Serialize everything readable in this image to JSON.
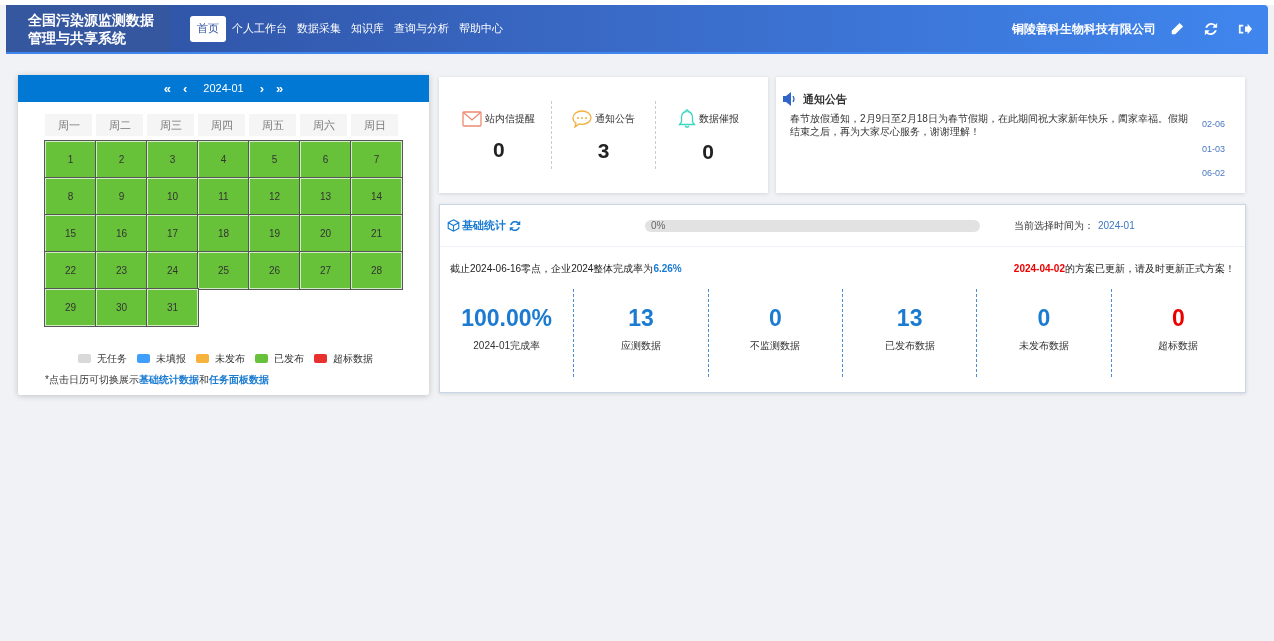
{
  "header": {
    "title": "全国污染源监测数据管理与共享系统",
    "nav": [
      {
        "label": "首页",
        "selected": true
      },
      {
        "label": "个人工作台",
        "selected": false
      },
      {
        "label": "数据采集",
        "selected": false
      },
      {
        "label": "知识库",
        "selected": false
      },
      {
        "label": "查询与分析",
        "selected": false
      },
      {
        "label": "帮助中心",
        "selected": false
      }
    ],
    "company": "铜陵善科生物科技有限公司"
  },
  "calendar": {
    "nav": {
      "first": "«",
      "prev": "‹",
      "month": "2024-01",
      "next": "›",
      "last": "»"
    },
    "weekdays": [
      "周一",
      "周二",
      "周三",
      "周四",
      "周五",
      "周六",
      "周日"
    ],
    "days": [
      {
        "day": "1",
        "color": "#67c23a"
      },
      {
        "day": "2",
        "color": "#67c23a"
      },
      {
        "day": "3",
        "color": "#67c23a"
      },
      {
        "day": "4",
        "color": "#67c23a"
      },
      {
        "day": "5",
        "color": "#67c23a"
      },
      {
        "day": "6",
        "color": "#67c23a"
      },
      {
        "day": "7",
        "color": "#67c23a"
      },
      {
        "day": "8",
        "color": "#67c23a"
      },
      {
        "day": "9",
        "color": "#67c23a"
      },
      {
        "day": "10",
        "color": "#67c23a"
      },
      {
        "day": "11",
        "color": "#67c23a"
      },
      {
        "day": "12",
        "color": "#67c23a"
      },
      {
        "day": "13",
        "color": "#67c23a"
      },
      {
        "day": "14",
        "color": "#67c23a"
      },
      {
        "day": "15",
        "color": "#67c23a"
      },
      {
        "day": "16",
        "color": "#67c23a"
      },
      {
        "day": "17",
        "color": "#67c23a"
      },
      {
        "day": "18",
        "color": "#67c23a"
      },
      {
        "day": "19",
        "color": "#67c23a"
      },
      {
        "day": "20",
        "color": "#67c23a"
      },
      {
        "day": "21",
        "color": "#67c23a"
      },
      {
        "day": "22",
        "color": "#67c23a"
      },
      {
        "day": "23",
        "color": "#67c23a"
      },
      {
        "day": "24",
        "color": "#67c23a"
      },
      {
        "day": "25",
        "color": "#67c23a"
      },
      {
        "day": "26",
        "color": "#67c23a"
      },
      {
        "day": "27",
        "color": "#67c23a"
      },
      {
        "day": "28",
        "color": "#67c23a"
      },
      {
        "day": "29",
        "color": "#67c23a"
      },
      {
        "day": "30",
        "color": "#67c23a"
      },
      {
        "day": "31",
        "color": "#67c23a"
      }
    ],
    "legend": [
      {
        "label": "无任务",
        "color": "#d9d9d9"
      },
      {
        "label": "未填报",
        "color": "#409eff"
      },
      {
        "label": "未发布",
        "color": "#f7b23b"
      },
      {
        "label": "已发布",
        "color": "#67c23a"
      },
      {
        "label": "超标数据",
        "color": "#e8312f"
      }
    ],
    "note": "*点击日历可切换展示**基础统计数据**和**任务面板数据**"
  },
  "counters": [
    {
      "kind": "mail",
      "label": "站内信提醒",
      "value": "0"
    },
    {
      "kind": "chat",
      "label": "通知公告",
      "value": "3"
    },
    {
      "kind": "bell",
      "label": "数据催报",
      "value": "0"
    }
  ],
  "notices": {
    "title": "通知公告",
    "items": [
      {
        "text": "春节放假通知，2月9日至2月18日为春节假期，在此期间祝大家新年快乐，阖家幸福。假期结束之后，再为大家尽心服务，谢谢理解！",
        "date": "02-06"
      },
      {
        "date": "01-03"
      },
      {
        "date": "06-02"
      }
    ]
  },
  "stats": {
    "title": "基础统计",
    "progress": {
      "level": 0,
      "label": "0%"
    },
    "time_label": "当前选择时间为：",
    "time_value": "2024-01",
    "summary": "截止2024-06-16零点，企业2024整体完成率为**6.26%**",
    "update_date": "2024-04-02",
    "update_text": "的方案已更新，请及时更新正式方案！",
    "items": [
      {
        "value": "100.00%",
        "label": "2024-01完成率",
        "color": "#1a7bd1"
      },
      {
        "value": "13",
        "label": "应测数据",
        "color": "#1a7bd1"
      },
      {
        "value": "0",
        "label": "不监测数据",
        "color": "#1a7bd1"
      },
      {
        "value": "13",
        "label": "已发布数据",
        "color": "#1a7bd1"
      },
      {
        "value": "0",
        "label": "未发布数据",
        "color": "#1a7bd1"
      },
      {
        "value": "0",
        "label": "超标数据",
        "color": "#ee0000"
      }
    ]
  }
}
